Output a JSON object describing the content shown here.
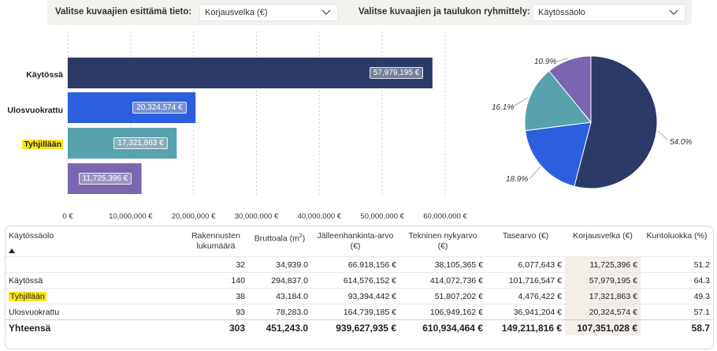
{
  "filters": {
    "label1": "Valitse kuvaajien esittämä tieto:",
    "value1": "Korjausvelka (€)",
    "label2": "Valitse kuvaajien ja taulukon ryhmittely:",
    "value2": "Käytössäolo"
  },
  "colors": {
    "kaytossa": "#2b3a67",
    "ulosvuokrattu": "#2c5fde",
    "tyhjillaan": "#57a2ad",
    "unnamed": "#7a67b0",
    "highlight": "#fde51b"
  },
  "chart_data": [
    {
      "type": "bar",
      "orientation": "horizontal",
      "categories": [
        "Käytössä",
        "Ulosvuokrattu",
        "Tyhjillään",
        ""
      ],
      "values": [
        57979195,
        20324574,
        17321863,
        11725396
      ],
      "value_labels": [
        "57,979,195 €",
        "20,324,574 €",
        "17,321,863 €",
        "11,725,396 €"
      ],
      "xlim": [
        0,
        60000000
      ],
      "ticks": [
        "0 €",
        "10,000,000 €",
        "20,000,000 €",
        "30,000,000 €",
        "40,000,000 €",
        "50,000,000 €",
        "60,000,000 €"
      ],
      "grid": true
    },
    {
      "type": "pie",
      "labels": [
        "Käytössä",
        "Ulosvuokrattu",
        "Tyhjillään",
        ""
      ],
      "values": [
        54.0,
        18.9,
        16.1,
        10.9
      ],
      "value_labels": [
        "54.0%",
        "18.9%",
        "16.1%",
        "10.9%"
      ]
    }
  ],
  "table": {
    "headers": [
      "Käytössäolo",
      "Rakennusten lukumäärä",
      "Bruttoala (m²)",
      "Jälleenhankinta-arvo (€)",
      "Tekninen nykyarvo (€)",
      "Tasearvo (€)",
      "Korjausvelka (€)",
      "Kuntoluokka (%)"
    ],
    "rows": [
      [
        "",
        "32",
        "34,939.0",
        "66,918,156 €",
        "38,105,365 €",
        "6,077,643 €",
        "11,725,396 €",
        "51.2"
      ],
      [
        "Käytössä",
        "140",
        "294,837.0",
        "614,576,152 €",
        "414,072,736 €",
        "101,716,547 €",
        "57,979,195 €",
        "64.3"
      ],
      [
        "Tyhjillään",
        "38",
        "43,184.0",
        "93,394,442 €",
        "51,807,202 €",
        "4,476,422 €",
        "17,321,863 €",
        "49.3"
      ],
      [
        "Ulosvuokrattu",
        "93",
        "78,283.0",
        "164,739,185 €",
        "106,949,162 €",
        "36,941,204 €",
        "20,324,574 €",
        "57.1"
      ]
    ],
    "total": [
      "Yhteensä",
      "303",
      "451,243.0",
      "939,627,935 €",
      "610,934,464 €",
      "149,211,816 €",
      "107,351,028 €",
      "58.7"
    ]
  }
}
